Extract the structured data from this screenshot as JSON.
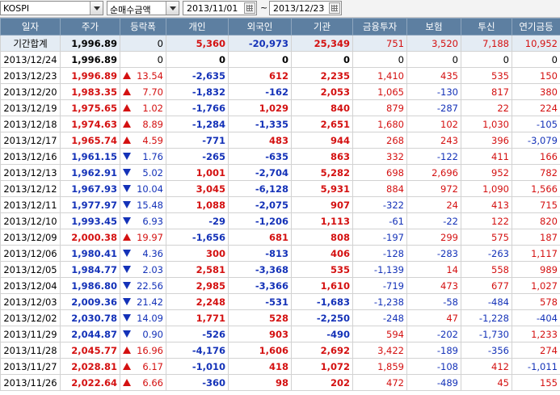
{
  "toolbar": {
    "market": "KOSPI",
    "metric": "순매수금액",
    "date_from": "2013/11/01",
    "date_to": "2013/12/23",
    "tilde": "~"
  },
  "columns": [
    "일자",
    "주가",
    "등락폭",
    "개인",
    "외국인",
    "기관",
    "금융투자",
    "보험",
    "투신",
    "연기금등"
  ],
  "summary": {
    "label": "기간합계",
    "price": "1,996.89",
    "change": "0",
    "individual": "5,360",
    "foreign": "-20,973",
    "institution": "25,349",
    "fin_invest": "751",
    "insurance": "3,520",
    "trust": "7,188",
    "pension": "10,952"
  },
  "rows": [
    {
      "date": "2013/12/24",
      "price": "1,996.89",
      "dir": "none",
      "change": "0",
      "individual": "0",
      "foreign": "0",
      "institution": "0",
      "fin_invest": "0",
      "insurance": "0",
      "trust": "0",
      "pension": "0"
    },
    {
      "date": "2013/12/23",
      "price": "1,996.89",
      "dir": "up",
      "change": "13.54",
      "individual": "-2,635",
      "foreign": "612",
      "institution": "2,235",
      "fin_invest": "1,410",
      "insurance": "435",
      "trust": "535",
      "pension": "150"
    },
    {
      "date": "2013/12/20",
      "price": "1,983.35",
      "dir": "up",
      "change": "7.70",
      "individual": "-1,832",
      "foreign": "-162",
      "institution": "2,053",
      "fin_invest": "1,065",
      "insurance": "-130",
      "trust": "817",
      "pension": "380"
    },
    {
      "date": "2013/12/19",
      "price": "1,975.65",
      "dir": "up",
      "change": "1.02",
      "individual": "-1,766",
      "foreign": "1,029",
      "institution": "840",
      "fin_invest": "879",
      "insurance": "-287",
      "trust": "22",
      "pension": "224"
    },
    {
      "date": "2013/12/18",
      "price": "1,974.63",
      "dir": "up",
      "change": "8.89",
      "individual": "-1,284",
      "foreign": "-1,335",
      "institution": "2,651",
      "fin_invest": "1,680",
      "insurance": "102",
      "trust": "1,030",
      "pension": "-105"
    },
    {
      "date": "2013/12/17",
      "price": "1,965.74",
      "dir": "up",
      "change": "4.59",
      "individual": "-771",
      "foreign": "483",
      "institution": "944",
      "fin_invest": "268",
      "insurance": "243",
      "trust": "396",
      "pension": "-3,079"
    },
    {
      "date": "2013/12/16",
      "price": "1,961.15",
      "dir": "down",
      "change": "1.76",
      "individual": "-265",
      "foreign": "-635",
      "institution": "863",
      "fin_invest": "332",
      "insurance": "-122",
      "trust": "411",
      "pension": "166"
    },
    {
      "date": "2013/12/13",
      "price": "1,962.91",
      "dir": "down",
      "change": "5.02",
      "individual": "1,001",
      "foreign": "-2,704",
      "institution": "5,282",
      "fin_invest": "698",
      "insurance": "2,696",
      "trust": "952",
      "pension": "782"
    },
    {
      "date": "2013/12/12",
      "price": "1,967.93",
      "dir": "down",
      "change": "10.04",
      "individual": "3,045",
      "foreign": "-6,128",
      "institution": "5,931",
      "fin_invest": "884",
      "insurance": "972",
      "trust": "1,090",
      "pension": "1,566"
    },
    {
      "date": "2013/12/11",
      "price": "1,977.97",
      "dir": "down",
      "change": "15.48",
      "individual": "1,088",
      "foreign": "-2,075",
      "institution": "907",
      "fin_invest": "-322",
      "insurance": "24",
      "trust": "413",
      "pension": "715"
    },
    {
      "date": "2013/12/10",
      "price": "1,993.45",
      "dir": "down",
      "change": "6.93",
      "individual": "-29",
      "foreign": "-1,206",
      "institution": "1,113",
      "fin_invest": "-61",
      "insurance": "-22",
      "trust": "122",
      "pension": "820"
    },
    {
      "date": "2013/12/09",
      "price": "2,000.38",
      "dir": "up",
      "change": "19.97",
      "individual": "-1,656",
      "foreign": "681",
      "institution": "808",
      "fin_invest": "-197",
      "insurance": "299",
      "trust": "575",
      "pension": "187"
    },
    {
      "date": "2013/12/06",
      "price": "1,980.41",
      "dir": "down",
      "change": "4.36",
      "individual": "300",
      "foreign": "-813",
      "institution": "406",
      "fin_invest": "-128",
      "insurance": "-283",
      "trust": "-263",
      "pension": "1,117"
    },
    {
      "date": "2013/12/05",
      "price": "1,984.77",
      "dir": "down",
      "change": "2.03",
      "individual": "2,581",
      "foreign": "-3,368",
      "institution": "535",
      "fin_invest": "-1,139",
      "insurance": "14",
      "trust": "558",
      "pension": "989"
    },
    {
      "date": "2013/12/04",
      "price": "1,986.80",
      "dir": "down",
      "change": "22.56",
      "individual": "2,985",
      "foreign": "-3,366",
      "institution": "1,610",
      "fin_invest": "-719",
      "insurance": "473",
      "trust": "677",
      "pension": "1,027"
    },
    {
      "date": "2013/12/03",
      "price": "2,009.36",
      "dir": "down",
      "change": "21.42",
      "individual": "2,248",
      "foreign": "-531",
      "institution": "-1,683",
      "fin_invest": "-1,238",
      "insurance": "-58",
      "trust": "-484",
      "pension": "578"
    },
    {
      "date": "2013/12/02",
      "price": "2,030.78",
      "dir": "down",
      "change": "14.09",
      "individual": "1,771",
      "foreign": "528",
      "institution": "-2,250",
      "fin_invest": "-248",
      "insurance": "47",
      "trust": "-1,228",
      "pension": "-404"
    },
    {
      "date": "2013/11/29",
      "price": "2,044.87",
      "dir": "down",
      "change": "0.90",
      "individual": "-526",
      "foreign": "903",
      "institution": "-490",
      "fin_invest": "594",
      "insurance": "-202",
      "trust": "-1,730",
      "pension": "1,233"
    },
    {
      "date": "2013/11/28",
      "price": "2,045.77",
      "dir": "up",
      "change": "16.96",
      "individual": "-4,176",
      "foreign": "1,606",
      "institution": "2,692",
      "fin_invest": "3,422",
      "insurance": "-189",
      "trust": "-356",
      "pension": "274"
    },
    {
      "date": "2013/11/27",
      "price": "2,028.81",
      "dir": "up",
      "change": "6.17",
      "individual": "-1,010",
      "foreign": "418",
      "institution": "1,072",
      "fin_invest": "1,859",
      "insurance": "-108",
      "trust": "412",
      "pension": "-1,011"
    },
    {
      "date": "2013/11/26",
      "price": "2,022.64",
      "dir": "up",
      "change": "6.66",
      "individual": "-360",
      "foreign": "98",
      "institution": "202",
      "fin_invest": "472",
      "insurance": "-489",
      "trust": "45",
      "pension": "155"
    }
  ],
  "colors": {
    "up": "#d41111",
    "down": "#1432b8",
    "header_bg": "#5d7fa1",
    "summary_bg": "#e4ecf4"
  }
}
